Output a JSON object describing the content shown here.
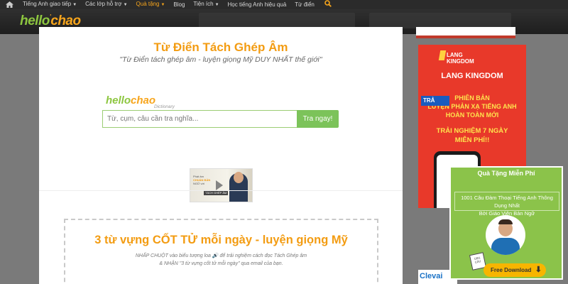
{
  "nav": {
    "items": [
      {
        "label": "Tiếng Anh giao tiếp",
        "caret": true
      },
      {
        "label": "Các lớp hỗ trợ",
        "caret": true
      },
      {
        "label": "Quà tặng",
        "caret": true,
        "active": true
      },
      {
        "label": "Blog",
        "caret": false
      },
      {
        "label": "Tiện ích",
        "caret": true
      },
      {
        "label": "Học tiếng Anh hiệu quả",
        "caret": false
      },
      {
        "label": "Từ điển",
        "caret": false
      }
    ]
  },
  "brand": {
    "part1": "hello",
    "dot": "'",
    "part2": "chao"
  },
  "main": {
    "title": "Từ Điển Tách Ghép Âm",
    "subtitle": "\"Từ Điển tách ghép âm - luyện giọng Mỹ DUY NHẤT thế giới\"",
    "dict_logo_part1": "hello",
    "dict_logo_part2": "chao",
    "dict_logo_sub": "Dictionary",
    "search_placeholder": "Từ, cụm, câu cần tra nghĩa...",
    "search_button": "Tra ngay!",
    "video_label_1": "Phát âm",
    "video_label_2": "CHUẨN BẢN",
    "video_label_3": "NGỮ với",
    "video_tag": "TÁCH GHÉP ÂM"
  },
  "promo": {
    "title": "3 từ vựng CỐT TỬ mỗi ngày - luyện giọng Mỹ",
    "line1": "NHẤP CHUỘT vào biểu tượng loa 🔊 để trải nghiệm cách đọc Tách Ghép âm",
    "line2": "& NHẬN \"3 từ vựng cốt tử mỗi ngày\" qua email của bạn."
  },
  "ad_lang": {
    "brand_line1": "LANG",
    "brand_line2": "KINGDOM",
    "name": "LANG KINGDOM",
    "l1": "PHIÊN BẢN",
    "l2": "LUYỆN PHẢN XẠ TIẾNG ANH",
    "l3": "HOÀN TOÀN MỚI",
    "l4": "TRẢI NGHIỆM 7 NGÀY",
    "l5": "MIỄN PHÍ!!",
    "phone_label": "TRẢ"
  },
  "ad_bottom": {
    "label": "Clevai"
  },
  "popup": {
    "title": "Quà Tặng Miễn Phí",
    "desc_line1": "1001 Câu Đàm Thoại Tiếng Anh Thông Dụng Nhất",
    "desc_line2": "Bởi Giáo Viên Bản Ngữ",
    "book_label": "1001 CÂU",
    "button": "Free Download"
  }
}
